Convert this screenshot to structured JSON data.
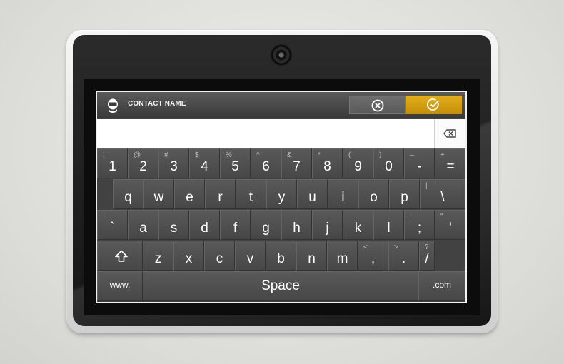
{
  "header": {
    "title": "CONTACT NAME",
    "contact_icon": "person-icon",
    "cancel_icon": "close-circle-icon",
    "confirm_icon": "check-circle-icon",
    "accent_color": "#d4a010"
  },
  "input": {
    "value": "",
    "backspace_icon": "backspace-icon"
  },
  "keyboard": {
    "row1": [
      {
        "main": "1",
        "alt": "!"
      },
      {
        "main": "2",
        "alt": "@"
      },
      {
        "main": "3",
        "alt": "#"
      },
      {
        "main": "4",
        "alt": "$"
      },
      {
        "main": "5",
        "alt": "%"
      },
      {
        "main": "6",
        "alt": "^"
      },
      {
        "main": "7",
        "alt": "&"
      },
      {
        "main": "8",
        "alt": "*"
      },
      {
        "main": "9",
        "alt": "("
      },
      {
        "main": "0",
        "alt": ")"
      },
      {
        "main": "-",
        "alt": "–"
      },
      {
        "main": "=",
        "alt": "+"
      }
    ],
    "row2": [
      {
        "main": "q",
        "alt": ""
      },
      {
        "main": "w",
        "alt": ""
      },
      {
        "main": "e",
        "alt": ""
      },
      {
        "main": "r",
        "alt": ""
      },
      {
        "main": "t",
        "alt": ""
      },
      {
        "main": "y",
        "alt": ""
      },
      {
        "main": "u",
        "alt": ""
      },
      {
        "main": "i",
        "alt": ""
      },
      {
        "main": "o",
        "alt": ""
      },
      {
        "main": "p",
        "alt": ""
      },
      {
        "main": "\\",
        "alt": "|"
      }
    ],
    "row3": [
      {
        "main": "`",
        "alt": "~"
      },
      {
        "main": "a",
        "alt": ""
      },
      {
        "main": "s",
        "alt": ""
      },
      {
        "main": "d",
        "alt": ""
      },
      {
        "main": "f",
        "alt": ""
      },
      {
        "main": "g",
        "alt": ""
      },
      {
        "main": "h",
        "alt": ""
      },
      {
        "main": "j",
        "alt": ""
      },
      {
        "main": "k",
        "alt": ""
      },
      {
        "main": "l",
        "alt": ""
      },
      {
        "main": ";",
        "alt": ":"
      },
      {
        "main": "'",
        "alt": "\""
      }
    ],
    "row4": [
      {
        "main": "z",
        "alt": ""
      },
      {
        "main": "x",
        "alt": ""
      },
      {
        "main": "c",
        "alt": ""
      },
      {
        "main": "v",
        "alt": ""
      },
      {
        "main": "b",
        "alt": ""
      },
      {
        "main": "n",
        "alt": ""
      },
      {
        "main": "m",
        "alt": ""
      },
      {
        "main": ",",
        "alt": "<"
      },
      {
        "main": ".",
        "alt": ">"
      },
      {
        "main": "/",
        "alt": "?"
      }
    ],
    "shift_icon": "shift-icon",
    "www_label": "www.",
    "space_label": "Space",
    "com_label": ".com"
  }
}
